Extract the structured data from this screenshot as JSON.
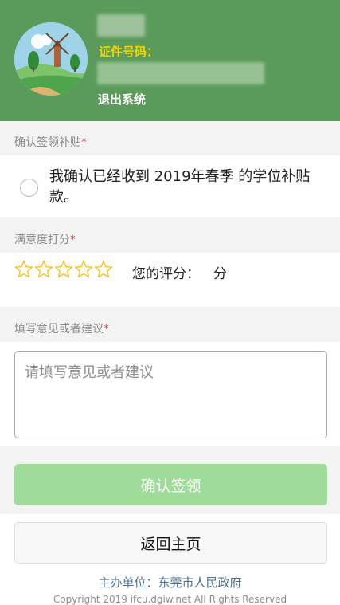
{
  "header": {
    "id_label": "证件号码：",
    "logout_label": "退出系统",
    "background_color": "#5a9a5a"
  },
  "confirm_section": {
    "label": "确认签领补贴",
    "required_mark": "*",
    "statement": "我确认已经收到 2019年春季 的学位补贴款。"
  },
  "rating_section": {
    "label": "满意度打分",
    "required_mark": "*",
    "star_count": 5,
    "your_score_label": "您的评分：",
    "score_unit": "分"
  },
  "feedback_section": {
    "label": "填写意见或者建议",
    "required_mark": "*",
    "placeholder": "请填写意见或者建议",
    "value": ""
  },
  "actions": {
    "confirm_label": "确认签领",
    "home_label": "返回主页",
    "confirm_color": "#9fdc9a"
  },
  "footer": {
    "organizer": "主办单位：东莞市人民政府",
    "copyright": "Copyright 2019 ifcu.dgiw.net All Rights Reserved"
  }
}
